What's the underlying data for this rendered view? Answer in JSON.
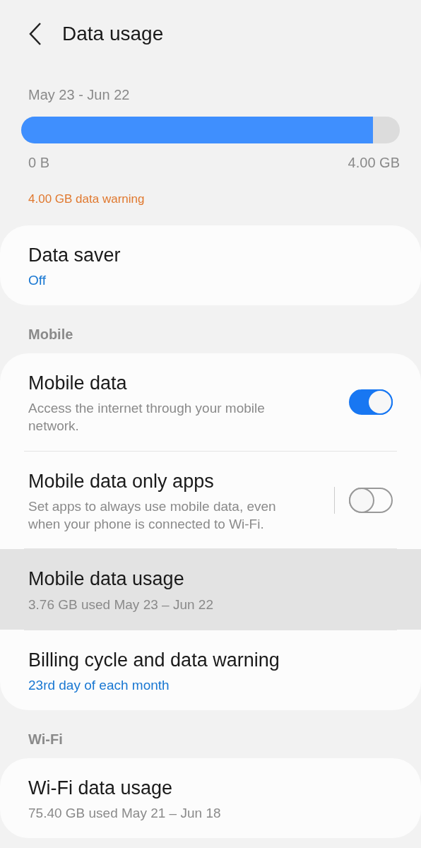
{
  "header": {
    "title": "Data usage"
  },
  "usage": {
    "period": "May 23 - Jun 22",
    "level": 0.93,
    "min_label": "0 B",
    "max_label": "4.00 GB",
    "warning": "4.00 GB data warning"
  },
  "sections": [
    {
      "items": [
        {
          "kind": "plain",
          "title": "Data saver",
          "subtitle": "Off",
          "subtitle_accent": true,
          "selected": false
        }
      ]
    },
    {
      "heading": "Mobile",
      "items": [
        {
          "kind": "toggle",
          "title": "Mobile data",
          "subtitle": "Access the internet through your mobile network.",
          "subtitle_accent": false,
          "on": true,
          "selected": false
        },
        {
          "kind": "split-toggle",
          "title": "Mobile data only apps",
          "subtitle": "Set apps to always use mobile data, even when your phone is connected to Wi-Fi.",
          "subtitle_accent": false,
          "on": false,
          "selected": false
        },
        {
          "kind": "plain",
          "title": "Mobile data usage",
          "subtitle": "3.76 GB used May 23 – Jun 22",
          "subtitle_accent": false,
          "selected": true
        },
        {
          "kind": "plain",
          "title": "Billing cycle and data warning",
          "subtitle": "23rd day of each month",
          "subtitle_accent": true,
          "selected": false
        }
      ]
    },
    {
      "heading": "Wi-Fi",
      "items": [
        {
          "kind": "plain",
          "title": "Wi-Fi data usage",
          "subtitle": "75.40 GB used May 21 – Jun 18",
          "subtitle_accent": false,
          "selected": false
        }
      ]
    }
  ]
}
